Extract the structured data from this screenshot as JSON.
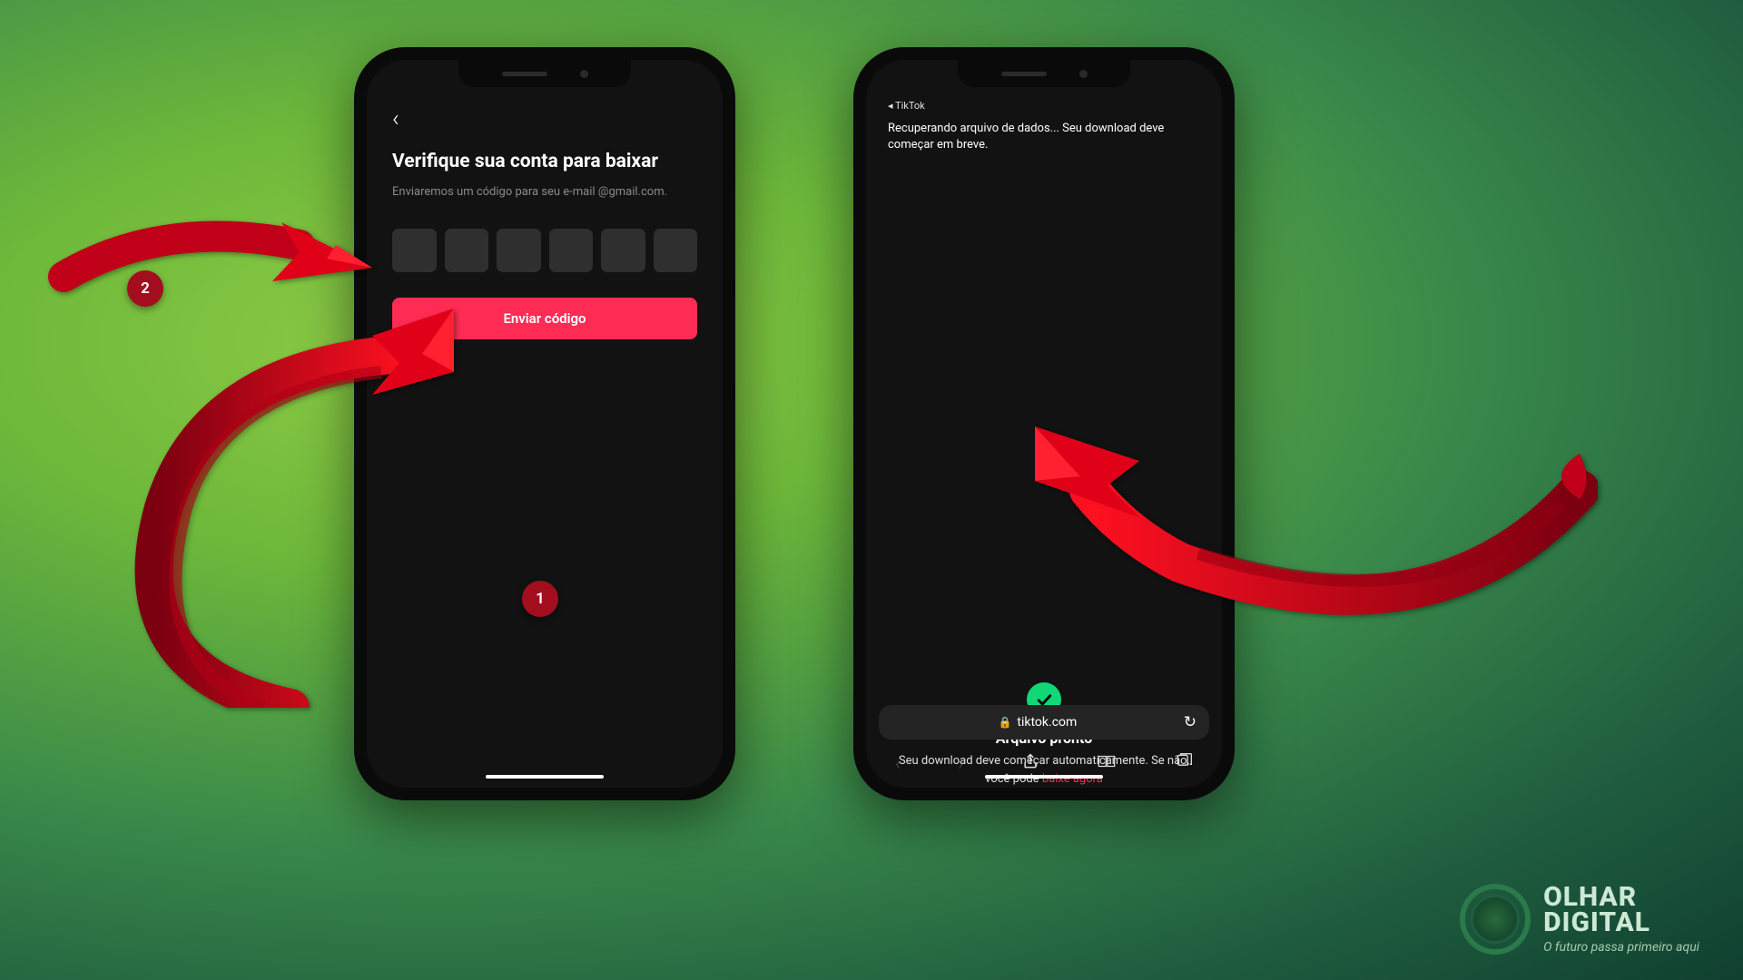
{
  "phone1": {
    "back": "‹",
    "title": "Verifique sua conta para baixar",
    "sub": "Enviaremos um código para seu e-mail @gmail.com.",
    "send": "Enviar código",
    "codeCount": 6
  },
  "phone2": {
    "tiktoklink": "◂ TikTok",
    "toast": "Recuperando arquivo de dados... Seu download deve começar em breve.",
    "readyTitle": "Arquivo pronto",
    "readySub": "Seu download deve começar automaticamente. Se não, você pode",
    "readyLink": "baixe agora",
    "url": "tiktok.com",
    "reload": "↻",
    "lock": "🔒",
    "nav": {
      "back": "‹",
      "fwd": "›",
      "share": "⎋",
      "book": "▢▢",
      "tabs": "⧉"
    }
  },
  "badges": {
    "b1": "1",
    "b2": "2"
  },
  "brand": {
    "line1": "OLHAR",
    "line2": "DIGITAL",
    "tag": "O futuro passa primeiro aqui"
  }
}
